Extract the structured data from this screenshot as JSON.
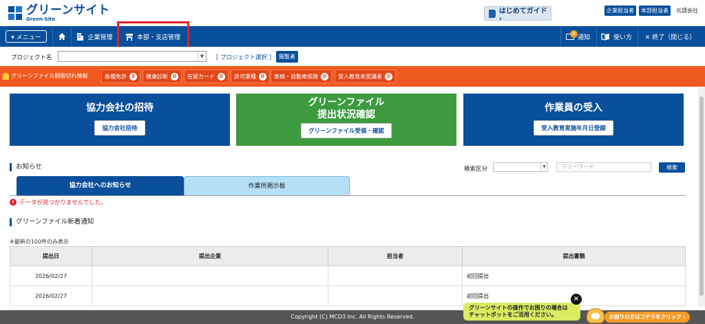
{
  "header": {
    "logo_jp": "グリーンサイト",
    "logo_en": "Green-Site",
    "guide_label": "はじめてガイド ›",
    "roles": [
      "企業担当者",
      "本部担当者"
    ],
    "company": "元請会社"
  },
  "nav": {
    "menu_label": "▾ メニュー",
    "corp_label": "企業管理",
    "branch_label": "本部・支店管理",
    "notify_label": "通知",
    "notify_count": "8",
    "howto_label": "使い方",
    "exit_label": "✕ 終了（閉じる）"
  },
  "project": {
    "label": "プロジェクト名",
    "select_link": "[ プロジェクト選択 ]",
    "viewer_badge": "閲覧者"
  },
  "alerts": {
    "title": "グリーンファイル期限切れ情報",
    "chips": [
      {
        "label": "各種免許",
        "count": "0"
      },
      {
        "label": "健康診断",
        "count": "0"
      },
      {
        "label": "在留カード",
        "count": "0"
      },
      {
        "label": "許可業種",
        "count": "0"
      },
      {
        "label": "車検・自動車保険",
        "count": "0"
      },
      {
        "label": "受入教育未受講者",
        "count": "0"
      }
    ]
  },
  "cards": [
    {
      "title": "協力会社の招待",
      "button": "協力会社招待"
    },
    {
      "title_line1": "グリーンファイル",
      "title_line2": "提出状況確認",
      "button": "グリーンファイル受領・確認"
    },
    {
      "title": "作業員の受入",
      "button": "受入教育実施年月日登録"
    }
  ],
  "notices": {
    "heading": "お知らせ",
    "search_label": "検索区分",
    "search_placeholder": "フリーワード",
    "search_button": "検索",
    "tab_active": "協力会社へのお知らせ",
    "tab_inactive": "作業所掲示板",
    "error": "データが見つかりませんでした。"
  },
  "greenfile": {
    "heading": "グリーンファイル新着通知",
    "note": "※最新の100件のみ表示",
    "columns": [
      "提出日",
      "提出企業",
      "担当者",
      "提出書類"
    ],
    "rows": [
      {
        "date": "2026/02/27",
        "company": "",
        "person": "",
        "doc": "初回提出"
      },
      {
        "date": "2026/02/27",
        "company": "",
        "person": "",
        "doc": "初回提出"
      }
    ]
  },
  "footer": {
    "copyright": "Copyright (C) MCD3 Inc. All Rights Reserved."
  },
  "chat": {
    "line1": "グリーンサイトの操作でお困りの場合は",
    "line2": "チャットボットをご活用ください。",
    "cta": "お困りの方はコチラをクリック ›"
  },
  "colors": {
    "brand": "#0a4f9c",
    "alert": "#f0591f",
    "green_card": "#3d9a3f",
    "highlight": "#e0212b"
  }
}
